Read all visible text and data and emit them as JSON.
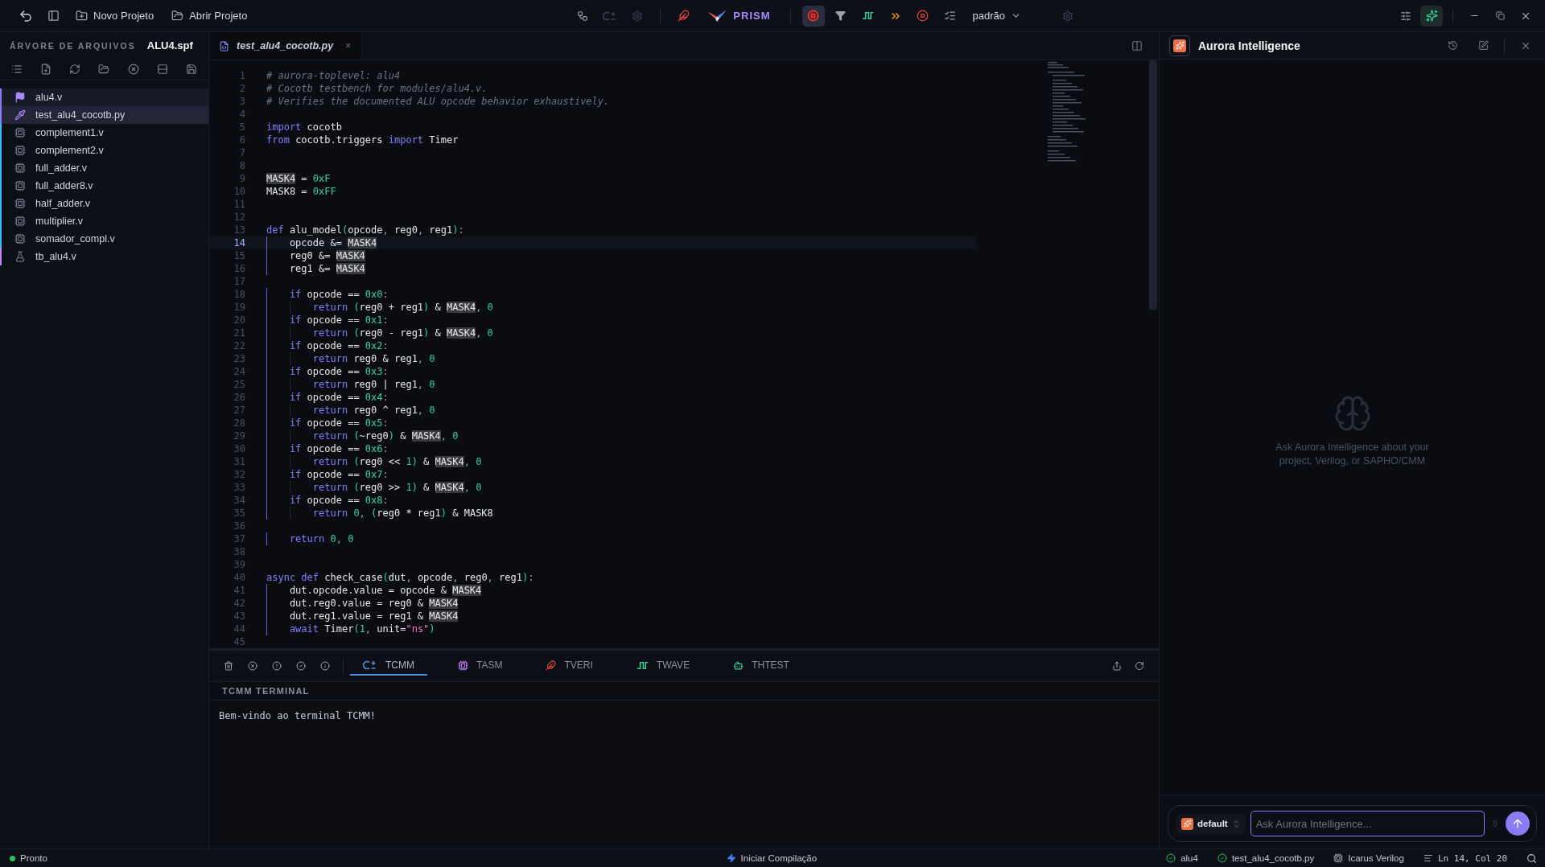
{
  "topbar": {
    "new_project": "Novo Projeto",
    "open_project": "Abrir Projeto",
    "brand": "PRISM",
    "view_toggles": [
      {
        "selected": true
      },
      {
        "selected": false
      }
    ],
    "profile": "padrão",
    "ai_toggle": {
      "on": true
    }
  },
  "sidebar": {
    "title": "ÁRVORE DE ARQUIVOS",
    "project": "ALU4.spf",
    "files": [
      {
        "name": "alu4.v",
        "kind": "toplevel",
        "selected": false
      },
      {
        "name": "test_alu4_cocotb.py",
        "kind": "test",
        "selected": true
      },
      {
        "name": "complement1.v",
        "kind": "module",
        "selected": false
      },
      {
        "name": "complement2.v",
        "kind": "module",
        "selected": false
      },
      {
        "name": "full_adder.v",
        "kind": "module",
        "selected": false
      },
      {
        "name": "full_adder8.v",
        "kind": "module",
        "selected": false
      },
      {
        "name": "half_adder.v",
        "kind": "module",
        "selected": false
      },
      {
        "name": "multiplier.v",
        "kind": "module",
        "selected": false
      },
      {
        "name": "somador_compl.v",
        "kind": "module",
        "selected": false
      },
      {
        "name": "tb_alu4.v",
        "kind": "testbench",
        "selected": false
      }
    ]
  },
  "editor": {
    "tab": {
      "title": "test_alu4_cocotb.py",
      "close": "×"
    },
    "lines": [
      {
        "n": "1",
        "current": false,
        "tokens": [
          {
            "kind": "comment",
            "text": "# aurora-toplevel: alu4"
          }
        ]
      },
      {
        "n": "2",
        "current": false,
        "tokens": [
          {
            "kind": "comment",
            "text": "# Cocotb testbench for modules/alu4.v."
          }
        ]
      },
      {
        "n": "3",
        "current": false,
        "tokens": [
          {
            "kind": "comment",
            "text": "# Verifies the documented ALU opcode behavior exhaustively."
          }
        ]
      },
      {
        "n": "4",
        "current": false
      },
      {
        "n": "5",
        "current": false,
        "tokens": [
          {
            "kind": "keyword",
            "text": "import"
          },
          {
            "kind": "plain",
            "text": " cocotb"
          }
        ]
      },
      {
        "n": "6",
        "current": false,
        "tokens": [
          {
            "kind": "keyword",
            "text": "from"
          },
          {
            "kind": "plain",
            "text": " cocotb.triggers "
          },
          {
            "kind": "keyword",
            "text": "import"
          },
          {
            "kind": "plain",
            "text": " Timer"
          }
        ]
      },
      {
        "n": "7",
        "current": false
      },
      {
        "n": "8",
        "current": false
      },
      {
        "n": "9",
        "current": false,
        "tokens": [
          {
            "kind": "match",
            "text": "MASK4"
          },
          {
            "kind": "plain",
            "text": " = "
          },
          {
            "kind": "number",
            "text": "0xF"
          }
        ]
      },
      {
        "n": "10",
        "current": false,
        "tokens": [
          {
            "kind": "plain",
            "text": "MASK8 = "
          },
          {
            "kind": "number",
            "text": "0xFF"
          }
        ]
      },
      {
        "n": "11",
        "current": false
      },
      {
        "n": "12",
        "current": false
      },
      {
        "n": "13",
        "current": false,
        "tokens": [
          {
            "kind": "keyword",
            "text": "def"
          },
          {
            "kind": "plain",
            "text": " alu_model"
          },
          {
            "kind": "paren",
            "text": "("
          },
          {
            "kind": "plain",
            "text": "opcode"
          },
          {
            "kind": "punct",
            "text": ", "
          },
          {
            "kind": "plain",
            "text": "reg0"
          },
          {
            "kind": "punct",
            "text": ", "
          },
          {
            "kind": "plain",
            "text": "reg1"
          },
          {
            "kind": "paren",
            "text": ")"
          },
          {
            "kind": "punct",
            "text": ":"
          }
        ]
      },
      {
        "n": "14",
        "current": true,
        "tokens": [
          {
            "kind": "plain",
            "text": "    opcode &= "
          },
          {
            "kind": "match",
            "text": "MASK4"
          }
        ]
      },
      {
        "n": "15",
        "current": false,
        "tokens": [
          {
            "kind": "plain",
            "text": "    reg0 &= "
          },
          {
            "kind": "match",
            "text": "MASK4"
          }
        ]
      },
      {
        "n": "16",
        "current": false,
        "tokens": [
          {
            "kind": "plain",
            "text": "    reg1 &= "
          },
          {
            "kind": "match",
            "text": "MASK4"
          }
        ]
      },
      {
        "n": "17",
        "current": false
      },
      {
        "n": "18",
        "current": false,
        "tokens": [
          {
            "kind": "keyword",
            "text": "    if"
          },
          {
            "kind": "plain",
            "text": " opcode == "
          },
          {
            "kind": "number",
            "text": "0x0"
          },
          {
            "kind": "punct",
            "text": ":"
          }
        ]
      },
      {
        "n": "19",
        "current": false,
        "tokens": [
          {
            "kind": "keyword",
            "text": "        return"
          },
          {
            "kind": "paren",
            "text": " ("
          },
          {
            "kind": "plain",
            "text": "reg0 + reg1"
          },
          {
            "kind": "paren",
            "text": ")"
          },
          {
            "kind": "plain",
            "text": " & "
          },
          {
            "kind": "match",
            "text": "MASK4"
          },
          {
            "kind": "punct",
            "text": ", "
          },
          {
            "kind": "number",
            "text": "0"
          }
        ]
      },
      {
        "n": "20",
        "current": false,
        "tokens": [
          {
            "kind": "keyword",
            "text": "    if"
          },
          {
            "kind": "plain",
            "text": " opcode == "
          },
          {
            "kind": "number",
            "text": "0x1"
          },
          {
            "kind": "punct",
            "text": ":"
          }
        ]
      },
      {
        "n": "21",
        "current": false,
        "tokens": [
          {
            "kind": "keyword",
            "text": "        return"
          },
          {
            "kind": "paren",
            "text": " ("
          },
          {
            "kind": "plain",
            "text": "reg0 - reg1"
          },
          {
            "kind": "paren",
            "text": ")"
          },
          {
            "kind": "plain",
            "text": " & "
          },
          {
            "kind": "match",
            "text": "MASK4"
          },
          {
            "kind": "punct",
            "text": ", "
          },
          {
            "kind": "number",
            "text": "0"
          }
        ]
      },
      {
        "n": "22",
        "current": false,
        "tokens": [
          {
            "kind": "keyword",
            "text": "    if"
          },
          {
            "kind": "plain",
            "text": " opcode == "
          },
          {
            "kind": "number",
            "text": "0x2"
          },
          {
            "kind": "punct",
            "text": ":"
          }
        ]
      },
      {
        "n": "23",
        "current": false,
        "tokens": [
          {
            "kind": "keyword",
            "text": "        return"
          },
          {
            "kind": "plain",
            "text": " reg0 & reg1"
          },
          {
            "kind": "punct",
            "text": ", "
          },
          {
            "kind": "number",
            "text": "0"
          }
        ]
      },
      {
        "n": "24",
        "current": false,
        "tokens": [
          {
            "kind": "keyword",
            "text": "    if"
          },
          {
            "kind": "plain",
            "text": " opcode == "
          },
          {
            "kind": "number",
            "text": "0x3"
          },
          {
            "kind": "punct",
            "text": ":"
          }
        ]
      },
      {
        "n": "25",
        "current": false,
        "tokens": [
          {
            "kind": "keyword",
            "text": "        return"
          },
          {
            "kind": "plain",
            "text": " reg0 | reg1"
          },
          {
            "kind": "punct",
            "text": ", "
          },
          {
            "kind": "number",
            "text": "0"
          }
        ]
      },
      {
        "n": "26",
        "current": false,
        "tokens": [
          {
            "kind": "keyword",
            "text": "    if"
          },
          {
            "kind": "plain",
            "text": " opcode == "
          },
          {
            "kind": "number",
            "text": "0x4"
          },
          {
            "kind": "punct",
            "text": ":"
          }
        ]
      },
      {
        "n": "27",
        "current": false,
        "tokens": [
          {
            "kind": "keyword",
            "text": "        return"
          },
          {
            "kind": "plain",
            "text": " reg0 ^ reg1"
          },
          {
            "kind": "punct",
            "text": ", "
          },
          {
            "kind": "number",
            "text": "0"
          }
        ]
      },
      {
        "n": "28",
        "current": false,
        "tokens": [
          {
            "kind": "keyword",
            "text": "    if"
          },
          {
            "kind": "plain",
            "text": " opcode == "
          },
          {
            "kind": "number",
            "text": "0x5"
          },
          {
            "kind": "punct",
            "text": ":"
          }
        ]
      },
      {
        "n": "29",
        "current": false,
        "tokens": [
          {
            "kind": "keyword",
            "text": "        return"
          },
          {
            "kind": "paren",
            "text": " ("
          },
          {
            "kind": "plain",
            "text": "~reg0"
          },
          {
            "kind": "paren",
            "text": ")"
          },
          {
            "kind": "plain",
            "text": " & "
          },
          {
            "kind": "match",
            "text": "MASK4"
          },
          {
            "kind": "punct",
            "text": ", "
          },
          {
            "kind": "number",
            "text": "0"
          }
        ]
      },
      {
        "n": "30",
        "current": false,
        "tokens": [
          {
            "kind": "keyword",
            "text": "    if"
          },
          {
            "kind": "plain",
            "text": " opcode == "
          },
          {
            "kind": "number",
            "text": "0x6"
          },
          {
            "kind": "punct",
            "text": ":"
          }
        ]
      },
      {
        "n": "31",
        "current": false,
        "tokens": [
          {
            "kind": "keyword",
            "text": "        return"
          },
          {
            "kind": "paren",
            "text": " ("
          },
          {
            "kind": "plain",
            "text": "reg0 << "
          },
          {
            "kind": "number",
            "text": "1"
          },
          {
            "kind": "paren",
            "text": ")"
          },
          {
            "kind": "plain",
            "text": " & "
          },
          {
            "kind": "match",
            "text": "MASK4"
          },
          {
            "kind": "punct",
            "text": ", "
          },
          {
            "kind": "number",
            "text": "0"
          }
        ]
      },
      {
        "n": "32",
        "current": false,
        "tokens": [
          {
            "kind": "keyword",
            "text": "    if"
          },
          {
            "kind": "plain",
            "text": " opcode == "
          },
          {
            "kind": "number",
            "text": "0x7"
          },
          {
            "kind": "punct",
            "text": ":"
          }
        ]
      },
      {
        "n": "33",
        "current": false,
        "tokens": [
          {
            "kind": "keyword",
            "text": "        return"
          },
          {
            "kind": "paren",
            "text": " ("
          },
          {
            "kind": "plain",
            "text": "reg0 >> "
          },
          {
            "kind": "number",
            "text": "1"
          },
          {
            "kind": "paren",
            "text": ")"
          },
          {
            "kind": "plain",
            "text": " & "
          },
          {
            "kind": "match",
            "text": "MASK4"
          },
          {
            "kind": "punct",
            "text": ", "
          },
          {
            "kind": "number",
            "text": "0"
          }
        ]
      },
      {
        "n": "34",
        "current": false,
        "tokens": [
          {
            "kind": "keyword",
            "text": "    if"
          },
          {
            "kind": "plain",
            "text": " opcode == "
          },
          {
            "kind": "number",
            "text": "0x8"
          },
          {
            "kind": "punct",
            "text": ":"
          }
        ]
      },
      {
        "n": "35",
        "current": false,
        "tokens": [
          {
            "kind": "keyword",
            "text": "        return"
          },
          {
            "kind": "number",
            "text": " 0"
          },
          {
            "kind": "punct",
            "text": ", "
          },
          {
            "kind": "paren",
            "text": "("
          },
          {
            "kind": "plain",
            "text": "reg0 * reg1"
          },
          {
            "kind": "paren",
            "text": ")"
          },
          {
            "kind": "plain",
            "text": " & MASK8"
          }
        ]
      },
      {
        "n": "36",
        "current": false
      },
      {
        "n": "37",
        "current": false,
        "tokens": [
          {
            "kind": "keyword",
            "text": "    return"
          },
          {
            "kind": "number",
            "text": " 0"
          },
          {
            "kind": "punct",
            "text": ", "
          },
          {
            "kind": "number",
            "text": "0"
          }
        ]
      },
      {
        "n": "38",
        "current": false
      },
      {
        "n": "39",
        "current": false
      },
      {
        "n": "40",
        "current": false,
        "tokens": [
          {
            "kind": "keyword",
            "text": "async def"
          },
          {
            "kind": "plain",
            "text": " check_case"
          },
          {
            "kind": "paren",
            "text": "("
          },
          {
            "kind": "plain",
            "text": "dut"
          },
          {
            "kind": "punct",
            "text": ", "
          },
          {
            "kind": "plain",
            "text": "opcode"
          },
          {
            "kind": "punct",
            "text": ", "
          },
          {
            "kind": "plain",
            "text": "reg0"
          },
          {
            "kind": "punct",
            "text": ", "
          },
          {
            "kind": "plain",
            "text": "reg1"
          },
          {
            "kind": "paren",
            "text": ")"
          },
          {
            "kind": "punct",
            "text": ":"
          }
        ]
      },
      {
        "n": "41",
        "current": false,
        "tokens": [
          {
            "kind": "plain",
            "text": "    dut.opcode.value = opcode & "
          },
          {
            "kind": "match",
            "text": "MASK4"
          }
        ]
      },
      {
        "n": "42",
        "current": false,
        "tokens": [
          {
            "kind": "plain",
            "text": "    dut.reg0.value = reg0 & "
          },
          {
            "kind": "match",
            "text": "MASK4"
          }
        ]
      },
      {
        "n": "43",
        "current": false,
        "tokens": [
          {
            "kind": "plain",
            "text": "    dut.reg1.value = reg1 & "
          },
          {
            "kind": "match",
            "text": "MASK4"
          }
        ]
      },
      {
        "n": "44",
        "current": false,
        "tokens": [
          {
            "kind": "keyword",
            "text": "    await"
          },
          {
            "kind": "plain",
            "text": " Timer"
          },
          {
            "kind": "paren",
            "text": "("
          },
          {
            "kind": "number",
            "text": "1"
          },
          {
            "kind": "punct",
            "text": ", "
          },
          {
            "kind": "plain",
            "text": "unit="
          },
          {
            "kind": "string",
            "text": "\"ns\""
          },
          {
            "kind": "paren",
            "text": ")"
          }
        ]
      },
      {
        "n": "45",
        "current": false
      }
    ]
  },
  "panel": {
    "tabs": [
      {
        "label": "TCMM",
        "kind": "cmm",
        "selected": true
      },
      {
        "label": "TASM",
        "kind": "asm",
        "selected": false
      },
      {
        "label": "TVERI",
        "kind": "veri",
        "selected": false
      },
      {
        "label": "TWAVE",
        "kind": "wave",
        "selected": false
      },
      {
        "label": "THTEST",
        "kind": "htest",
        "selected": false
      }
    ],
    "header": "TCMM TERMINAL",
    "output": "Bem-vindo ao terminal TCMM!"
  },
  "assistant": {
    "title": "Aurora Intelligence",
    "empty_text": "Ask Aurora Intelligence about your project, Verilog, or SAPHO/CMM",
    "model": "default",
    "placeholder": "Ask Aurora Intelligence...",
    "count": "0"
  },
  "status_bar": {
    "state": "Pronto",
    "compile": "Iniciar Compilação",
    "top": "alu4",
    "file": "test_alu4_cocotb.py",
    "simulator": "Icarus Verilog",
    "position": "Ln 14, Col 20"
  }
}
